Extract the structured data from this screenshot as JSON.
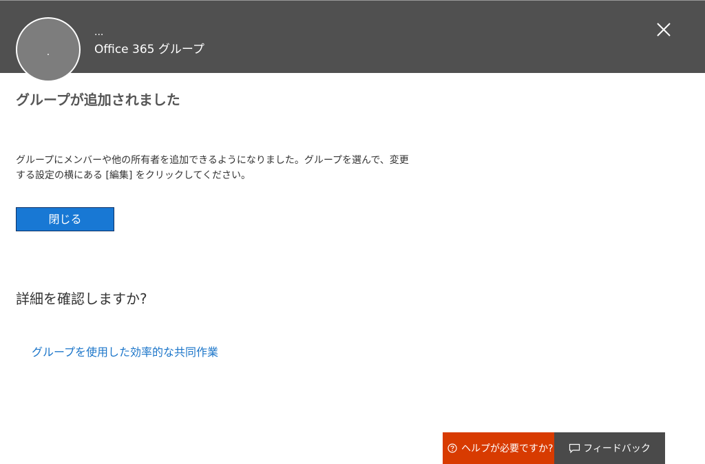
{
  "header": {
    "avatar_initial": ".",
    "group_name": "...",
    "group_type": "Office 365 グループ"
  },
  "main": {
    "title": "グループが追加されました",
    "description": "グループにメンバーや他の所有者を追加できるようになりました。グループを選んで、変更する設定の横にある [編集] をクリックしてください。",
    "close_label": "閉じる",
    "more_heading": "詳細を確認しますか?",
    "link_label": "グループを使用した効率的な共同作業"
  },
  "footer": {
    "help_label": "ヘルプが必要ですか?",
    "feedback_label": "フィードバック"
  },
  "colors": {
    "header_bg": "#505050",
    "primary_button": "#1878d4",
    "link": "#1b75c9",
    "help_bg": "#d83b01",
    "feedback_bg": "#4a4a4a"
  },
  "icons": {
    "close": "close-icon",
    "help": "question-circle-icon",
    "feedback": "speech-bubble-icon"
  }
}
